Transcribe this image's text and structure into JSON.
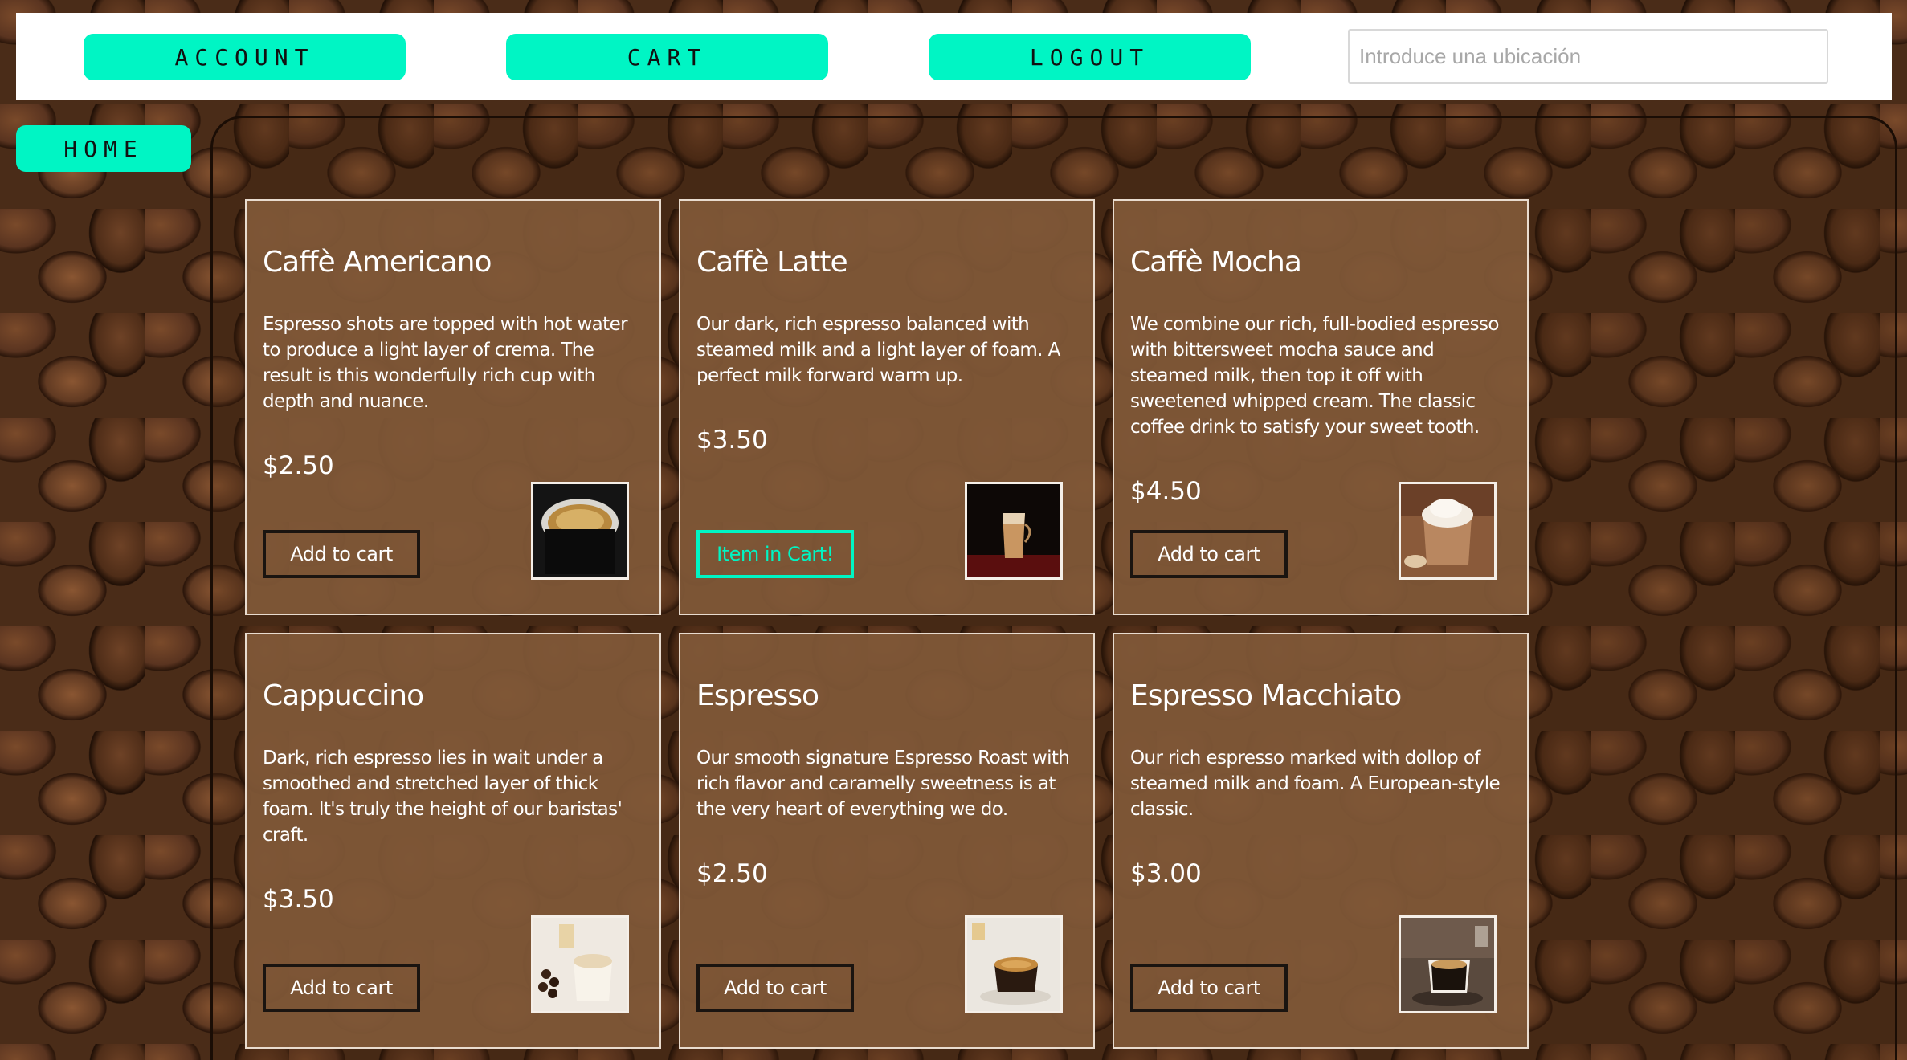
{
  "nav": {
    "account_label": "ACCOUNT",
    "cart_label": "CART",
    "logout_label": "LOGOUT",
    "search_placeholder": "Introduce una ubicación",
    "home_label": "HOME"
  },
  "colors": {
    "accent": "#00f5c4",
    "card_bg": "#805838",
    "card_border": "#e9dccf"
  },
  "products": [
    {
      "name": "Caffè Americano",
      "description": "Espresso shots are topped with hot water to produce a light layer of crema. The result is this wonderfully rich cup with depth and nuance.",
      "price": "$2.50",
      "button_label": "Add to cart",
      "image_icon": "americano-cup-icon"
    },
    {
      "name": "Caffè Latte",
      "description": "Our dark, rich espresso balanced with steamed milk and a light layer of foam. A perfect milk forward warm up.",
      "price": "$3.50",
      "button_label": "Item in Cart!",
      "image_icon": "latte-glass-icon"
    },
    {
      "name": "Caffè Mocha",
      "description": "We combine our rich, full-bodied espresso with bittersweet mocha sauce and steamed milk, then top it off with sweetened whipped cream. The classic coffee drink to satisfy your sweet tooth.",
      "price": "$4.50",
      "button_label": "Add to cart",
      "image_icon": "mocha-mug-icon"
    },
    {
      "name": "Cappuccino",
      "description": "Dark, rich espresso lies in wait under a smoothed and stretched layer of thick foam. It's truly the height of our baristas' craft.",
      "price": "$3.50",
      "button_label": "Add to cart",
      "image_icon": "cappuccino-cup-icon"
    },
    {
      "name": "Espresso",
      "description": "Our smooth signature Espresso Roast with rich flavor and caramelly sweetness is at the very heart of everything we do.",
      "price": "$2.50",
      "button_label": "Add to cart",
      "image_icon": "espresso-cup-icon"
    },
    {
      "name": "Espresso Macchiato",
      "description": "Our rich espresso marked with dollop of steamed milk and foam. A European-style classic.",
      "price": "$3.00",
      "button_label": "Add to cart",
      "image_icon": "macchiato-cup-icon"
    }
  ]
}
